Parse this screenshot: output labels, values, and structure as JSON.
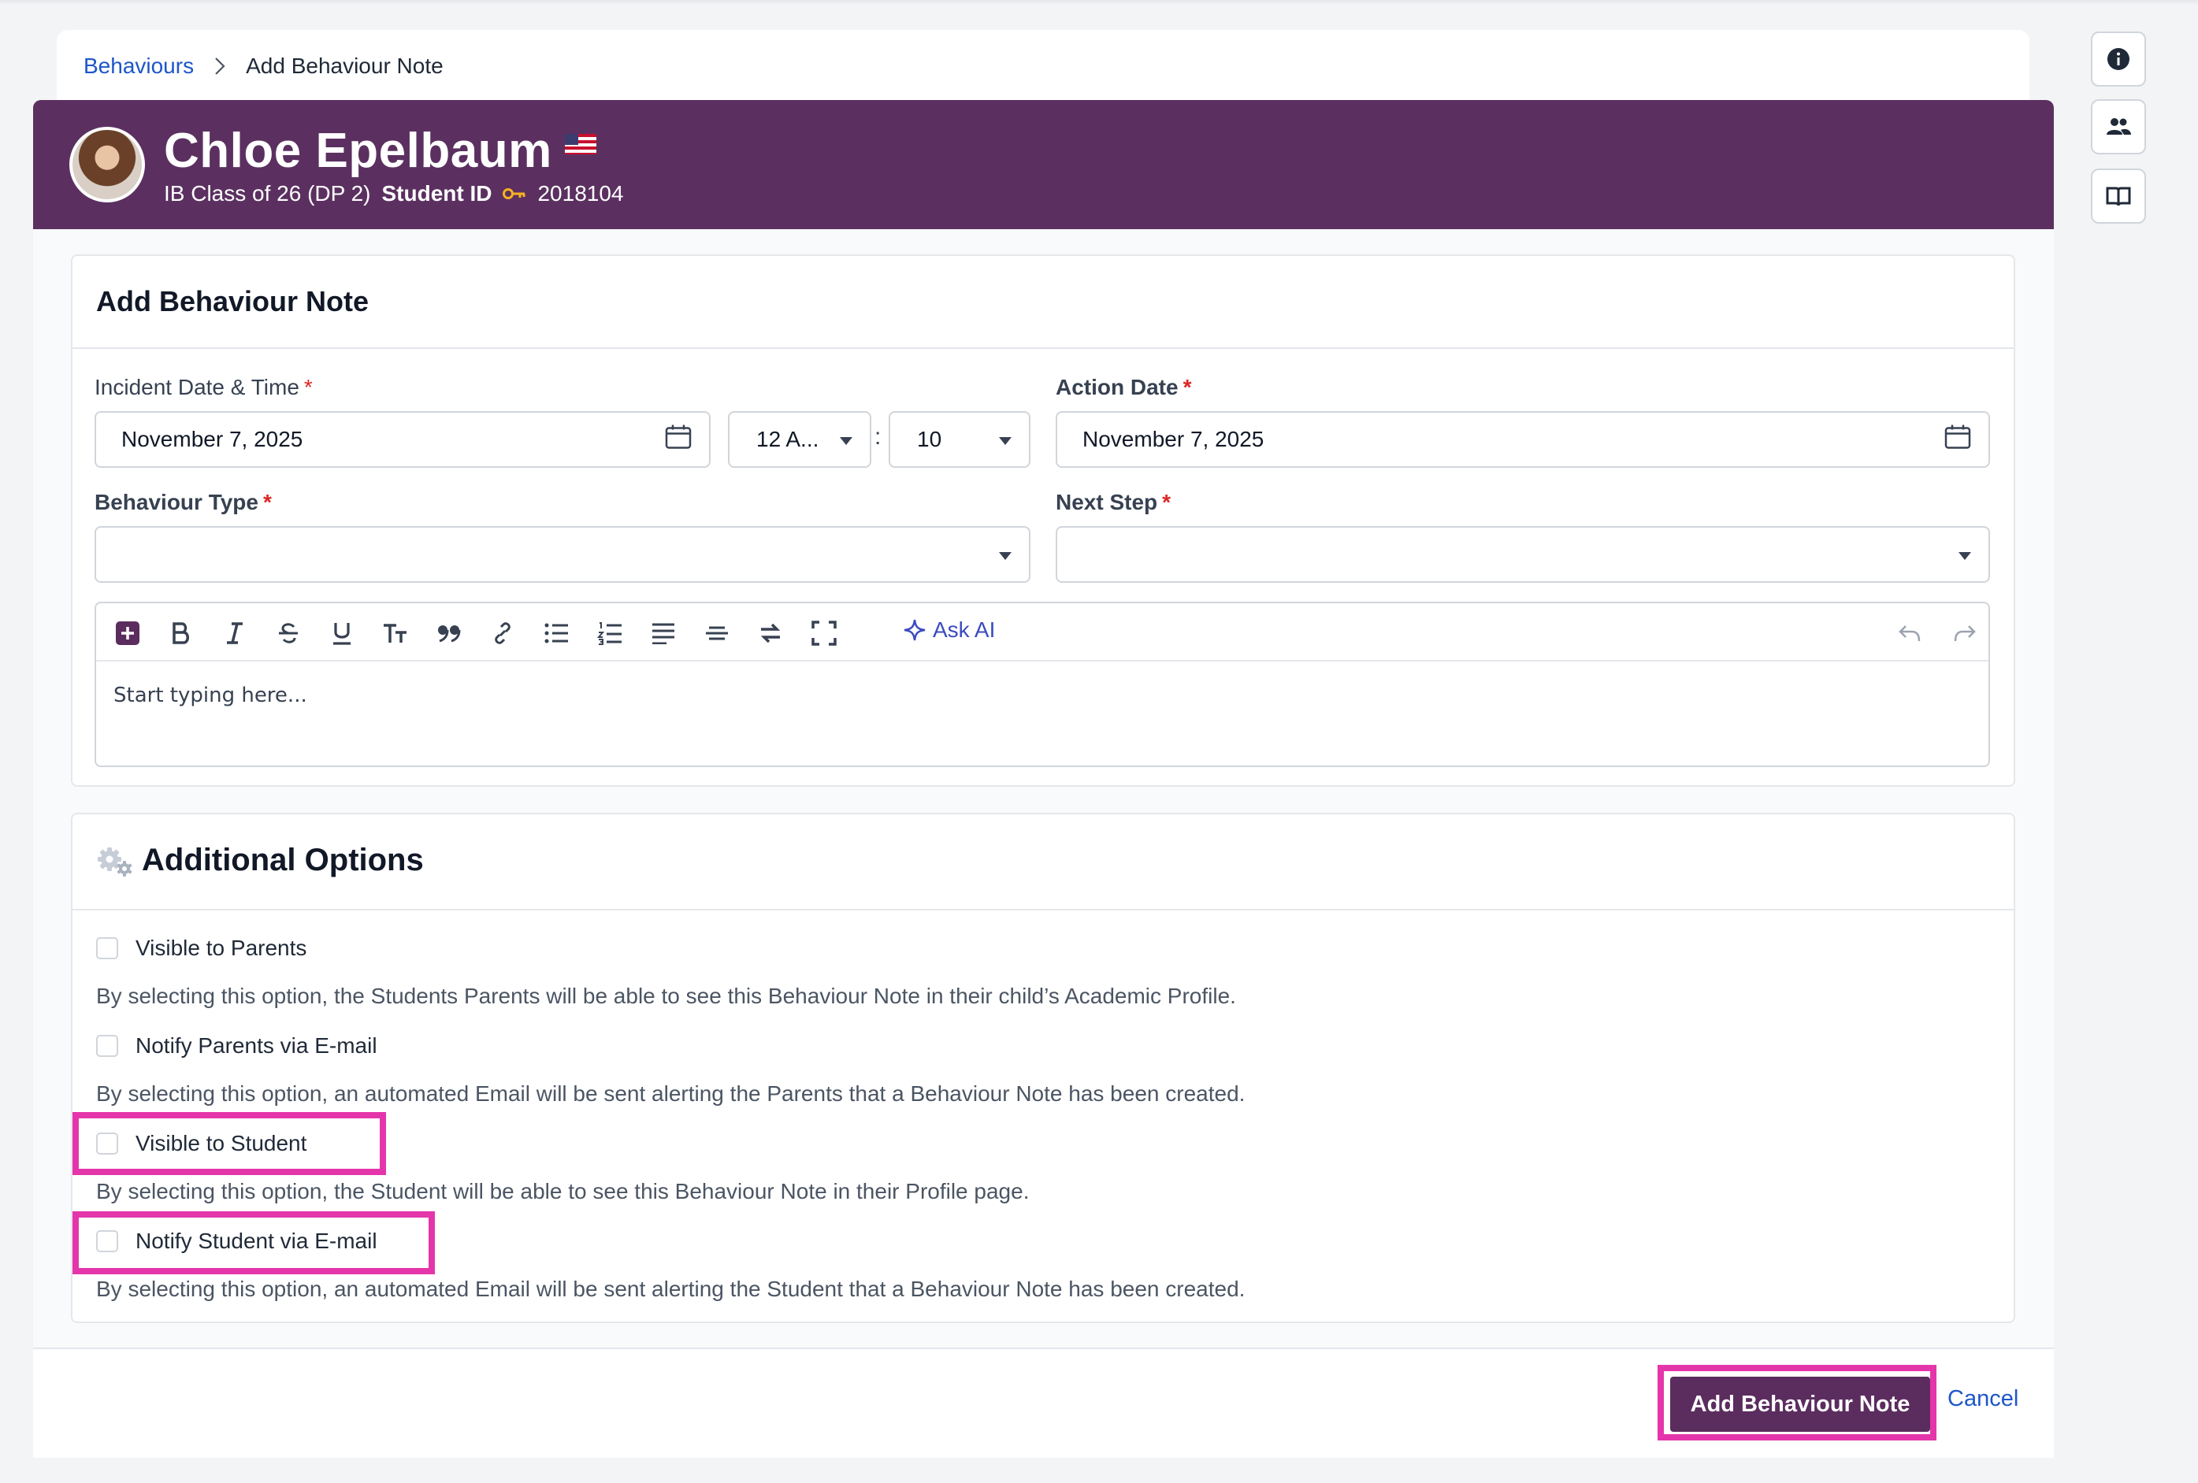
{
  "breadcrumb": {
    "parent": "Behaviours",
    "current": "Add Behaviour Note"
  },
  "student": {
    "name": "Chloe Epelbaum",
    "class_label": "IB Class of 26 (DP 2)",
    "id_label": "Student ID",
    "id_value": "2018104",
    "flag": "us-flag-icon"
  },
  "side_tools": [
    "info-icon",
    "users-icon",
    "book-icon"
  ],
  "form": {
    "title": "Add Behaviour Note",
    "incident_label": "Incident Date & Time",
    "incident_date": "November 7, 2025",
    "incident_hour": "12 A...",
    "time_separator": ":",
    "incident_minute": "10",
    "action_label": "Action Date",
    "action_date": "November 7, 2025",
    "behaviour_type_label": "Behaviour Type",
    "behaviour_type_value": "",
    "next_step_label": "Next Step",
    "next_step_value": "",
    "required_mark": "*"
  },
  "editor": {
    "toolbar": [
      "add-icon",
      "bold-icon",
      "italic-icon",
      "strikethrough-icon",
      "underline-icon",
      "text-size-icon",
      "quote-icon",
      "link-icon",
      "bullet-list-icon",
      "numbered-list-icon",
      "align-icon",
      "horizontal-rule-icon",
      "swap-icon",
      "fullscreen-icon"
    ],
    "ask_ai": "Ask AI",
    "placeholder": "Start typing here..."
  },
  "options": {
    "title": "Additional Options",
    "items": [
      {
        "label": "Visible to Parents",
        "checked": false,
        "description": "By selecting this option, the Students Parents will be able to see this Behaviour Note in their child’s Academic Profile."
      },
      {
        "label": "Notify Parents via E-mail",
        "checked": false,
        "description": "By selecting this option, an automated Email will be sent alerting the Parents that a Behaviour Note has been created."
      },
      {
        "label": "Visible to Student",
        "checked": false,
        "description": "By selecting this option, the Student will be able to see this Behaviour Note in their Profile page."
      },
      {
        "label": "Notify Student via E-mail",
        "checked": false,
        "description": "By selecting this option, an automated Email will be sent alerting the Student that a Behaviour Note has been created."
      }
    ]
  },
  "actions": {
    "submit": "Add Behaviour Note",
    "cancel": "Cancel"
  },
  "colors": {
    "header": "#5b3060",
    "primary_button": "#5b2c5e",
    "link": "#1e56c8",
    "highlight": "#e535ab",
    "required": "#dc2626"
  }
}
